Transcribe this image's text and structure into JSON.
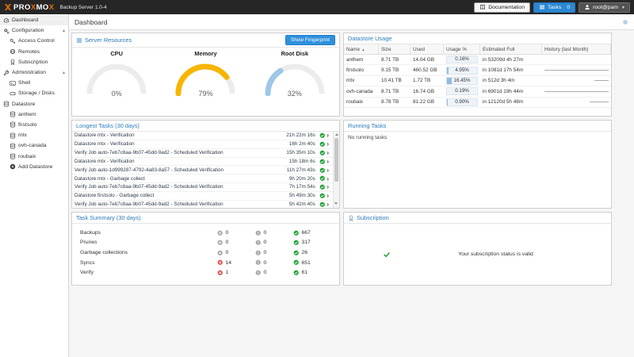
{
  "navbar": {
    "brand": "PROXMOX",
    "subtitle": "Backup Server 1.0-4",
    "documentation_label": "Documentation",
    "tasks_label": "Tasks",
    "tasks_count": "0",
    "user_label": "root@pam"
  },
  "sidebar": {
    "items": [
      {
        "label": "Dashboard",
        "icon": "gauge-icon",
        "selected": true
      },
      {
        "label": "Configuration",
        "icon": "gears-icon",
        "caret": true
      },
      {
        "label": "Access Control",
        "icon": "key-icon",
        "child": true
      },
      {
        "label": "Remotes",
        "icon": "globe-icon",
        "child": true
      },
      {
        "label": "Subscription",
        "icon": "ribbon-icon",
        "child": true
      },
      {
        "label": "Administration",
        "icon": "wrench-icon",
        "caret": true
      },
      {
        "label": "Shell",
        "icon": "terminal-icon",
        "child": true
      },
      {
        "label": "Storage / Disks",
        "icon": "hdd-icon",
        "child": true
      },
      {
        "label": "Datastore",
        "icon": "database-icon"
      },
      {
        "label": "anthem",
        "icon": "database-icon",
        "child": true
      },
      {
        "label": "firstsolo",
        "icon": "database-icon",
        "child": true
      },
      {
        "label": "mtx",
        "icon": "database-icon",
        "child": true
      },
      {
        "label": "ovh-canada",
        "icon": "database-icon",
        "child": true
      },
      {
        "label": "roubaix",
        "icon": "database-icon",
        "child": true
      },
      {
        "label": "Add Datastore",
        "icon": "plus-circle-icon",
        "child": true
      }
    ]
  },
  "toolbar": {
    "title": "Dashboard"
  },
  "server_resources": {
    "title": "Server Resources",
    "fingerprint_button": "Show Fingerprint",
    "gauges": [
      {
        "label": "CPU",
        "value": 0,
        "display": "0%",
        "color": "#b8b8b8"
      },
      {
        "label": "Memory",
        "value": 79,
        "display": "79%",
        "color": "#f7b500"
      },
      {
        "label": "Root Disk",
        "value": 32,
        "display": "32%",
        "color": "#9ec7e8"
      }
    ]
  },
  "datastore_usage": {
    "title": "Datastore Usage",
    "columns": [
      "Name",
      "Size",
      "Used",
      "Usage %",
      "Estimated Full",
      "History (last Month)"
    ],
    "rows": [
      {
        "name": "anthem",
        "size": "8.71 TB",
        "used": "14.04 GB",
        "usage": "0.16%",
        "usage_pct": 0.16,
        "estimated_full": "in 53209d 4h 27m",
        "history_frac": 0
      },
      {
        "name": "firstsolo",
        "size": "9.15 TB",
        "used": "460.52 GB",
        "usage": "4.95%",
        "usage_pct": 4.95,
        "estimated_full": "in 1081d 17h 54m",
        "history_frac": 1
      },
      {
        "name": "mtx",
        "size": "10.41 TB",
        "used": "1.72 TB",
        "usage": "16.45%",
        "usage_pct": 16.45,
        "estimated_full": "in 512d 3h 4m",
        "history_frac": 0.22
      },
      {
        "name": "ovh-canada",
        "size": "8.71 TB",
        "used": "16.74 GB",
        "usage": "0.19%",
        "usage_pct": 0.19,
        "estimated_full": "in 6901d 19h 44m",
        "history_frac": 1
      },
      {
        "name": "roubaix",
        "size": "8.78 TB",
        "used": "81.22 GB",
        "usage": "0.90%",
        "usage_pct": 0.9,
        "estimated_full": "in 12120d 5h 48m",
        "history_frac": 0.3
      }
    ]
  },
  "longest_tasks": {
    "title": "Longest Tasks (30 days)",
    "rows": [
      {
        "task": "Datastore mtx - Verification",
        "duration": "21h 22m 16s"
      },
      {
        "task": "Datastore mtx - Verification",
        "duration": "16h 2m 40s"
      },
      {
        "task": "Verify Job auto-7eb7c8aa-9b07-45dd-9ad2 - Scheduled Verification",
        "duration": "15h 35m 10s"
      },
      {
        "task": "Datastore mtx - Verification",
        "duration": "15h 18m 6s"
      },
      {
        "task": "Verify Job auto-1d999287-4792-4a83-8a57 - Scheduled Verification",
        "duration": "11h 27m 43s"
      },
      {
        "task": "Datastore mtx - Garbage collect",
        "duration": "9h 20m 20s"
      },
      {
        "task": "Verify Job auto-7eb7c8aa-9b07-45dd-9ad2 - Scheduled Verification",
        "duration": "7h 17m 54s"
      },
      {
        "task": "Datastore firstsolo - Garbage collect",
        "duration": "5h 49m 30s"
      },
      {
        "task": "Verify Job auto-7eb7c8aa-9b07-45dd-9ad2 - Scheduled Verification",
        "duration": "5h 42m 40s"
      }
    ]
  },
  "running_tasks": {
    "title": "Running Tasks",
    "empty_text": "No running tasks"
  },
  "task_summary": {
    "title": "Task Summary (30 days)",
    "rows": [
      {
        "label": "Backups",
        "error": 0,
        "warning": 0,
        "ok": 667
      },
      {
        "label": "Prunes",
        "error": 0,
        "warning": 0,
        "ok": 317
      },
      {
        "label": "Garbage collections",
        "error": 0,
        "warning": 0,
        "ok": 26
      },
      {
        "label": "Syncs",
        "error": 14,
        "warning": 0,
        "ok": 651
      },
      {
        "label": "Verify",
        "error": 1,
        "warning": 0,
        "ok": 61
      }
    ]
  },
  "subscription": {
    "title": "Subscription",
    "message": "Your subscription status is valid",
    "status_icon": "check-circle-icon"
  },
  "colors": {
    "navbar_bg": "#262626",
    "brand_orange": "#e57000",
    "accent_blue": "#2b87d3",
    "panel_title_blue": "#2b7bb9",
    "ok_green": "#23a33a",
    "error_red": "#d9534f",
    "neutral_gray": "#a8a8a8"
  }
}
